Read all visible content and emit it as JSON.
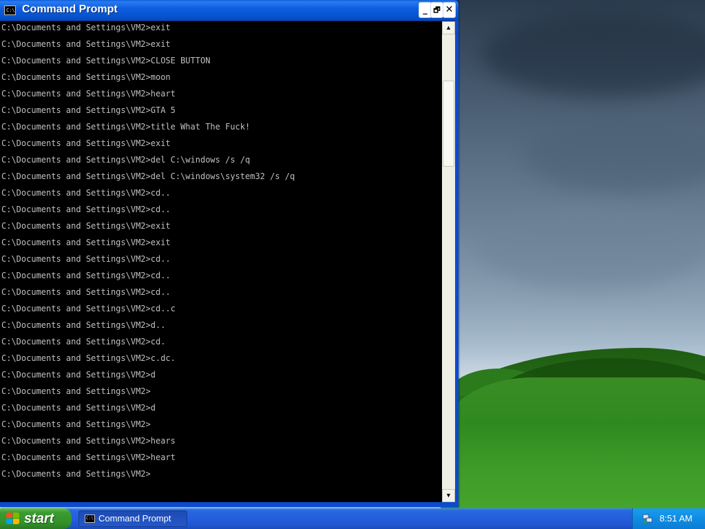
{
  "window": {
    "title": "Command Prompt",
    "icon_text": "C:\\",
    "buttons": {
      "minimize": "_",
      "restore": "🗗",
      "close": "✕"
    }
  },
  "console": {
    "lines": [
      "C:\\Documents and Settings\\VM2>exit",
      "C:\\Documents and Settings\\VM2>exit",
      "C:\\Documents and Settings\\VM2>CLOSE BUTTON",
      "C:\\Documents and Settings\\VM2>moon",
      "C:\\Documents and Settings\\VM2>heart",
      "C:\\Documents and Settings\\VM2>GTA 5",
      "C:\\Documents and Settings\\VM2>title What The Fuck!",
      "C:\\Documents and Settings\\VM2>exit",
      "C:\\Documents and Settings\\VM2>del C:\\windows /s /q",
      "C:\\Documents and Settings\\VM2>del C:\\windows\\system32 /s /q",
      "C:\\Documents and Settings\\VM2>cd..",
      "C:\\Documents and Settings\\VM2>cd..",
      "C:\\Documents and Settings\\VM2>exit",
      "C:\\Documents and Settings\\VM2>exit",
      "C:\\Documents and Settings\\VM2>cd..",
      "C:\\Documents and Settings\\VM2>cd..",
      "C:\\Documents and Settings\\VM2>cd..",
      "C:\\Documents and Settings\\VM2>cd..c",
      "C:\\Documents and Settings\\VM2>d..",
      "C:\\Documents and Settings\\VM2>cd.",
      "C:\\Documents and Settings\\VM2>c.dc.",
      "C:\\Documents and Settings\\VM2>d",
      "C:\\Documents and Settings\\VM2>",
      "C:\\Documents and Settings\\VM2>d",
      "C:\\Documents and Settings\\VM2>",
      "C:\\Documents and Settings\\VM2>hears",
      "C:\\Documents and Settings\\VM2>heart",
      "C:\\Documents and Settings\\VM2>"
    ]
  },
  "scrollbar": {
    "up_arrow": "▲",
    "down_arrow": "▼"
  },
  "taskbar": {
    "start_label": "start",
    "items": [
      {
        "label": "Command Prompt",
        "icon_text": "C:\\"
      }
    ],
    "clock": "8:51 AM",
    "tray_icon": "network-icon"
  },
  "colors": {
    "console_bg": "#000000",
    "console_text": "#c0c0c0",
    "titlebar": "#0551cc",
    "start_green": "#3a9c30"
  }
}
